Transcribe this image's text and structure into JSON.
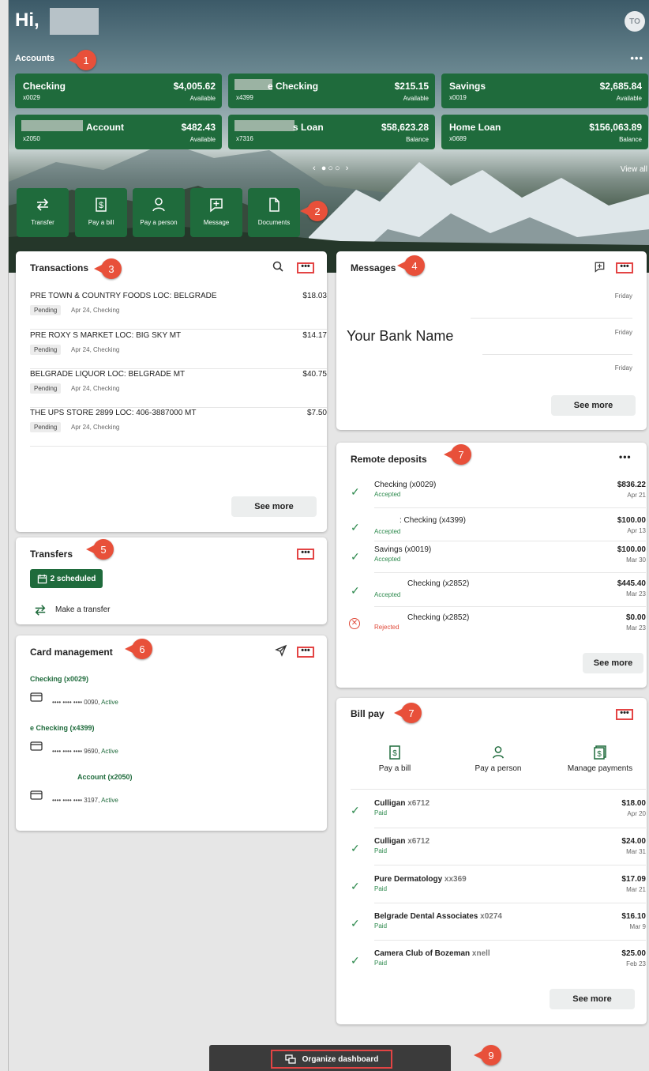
{
  "greeting": "Hi,",
  "avatar_initials": "TO",
  "accounts": {
    "title": "Accounts",
    "more": "•••",
    "view_all": "View all",
    "pager": "‹ ●○○ ›",
    "items": [
      {
        "name": "Checking",
        "number": "x0029",
        "amount": "$4,005.62",
        "label": "Available"
      },
      {
        "name": "e Checking",
        "number": "x4399",
        "amount": "$215.15",
        "label": "Available"
      },
      {
        "name": "Savings",
        "number": "x0019",
        "amount": "$2,685.84",
        "label": "Available"
      },
      {
        "name": "Account",
        "number": "x2050",
        "amount": "$482.43",
        "label": "Available"
      },
      {
        "name": "s Loan",
        "number": "x7316",
        "amount": "$58,623.28",
        "label": "Balance"
      },
      {
        "name": "Home Loan",
        "number": "x0689",
        "amount": "$156,063.89",
        "label": "Balance"
      }
    ]
  },
  "quick_actions": [
    "Transfer",
    "Pay a bill",
    "Pay a person",
    "Message",
    "Documents"
  ],
  "badges": [
    "1",
    "2",
    "3",
    "4",
    "5",
    "6",
    "7",
    "7",
    "9"
  ],
  "transactions": {
    "title": "Transactions",
    "more": "•••",
    "see_more": "See more",
    "items": [
      {
        "desc": "PRE TOWN & COUNTRY FOODS LOC: BELGRADE",
        "amount": "$18.03",
        "status": "Pending",
        "sub": "Apr 24, Checking"
      },
      {
        "desc": "PRE ROXY S MARKET LOC: BIG SKY MT",
        "amount": "$14.17",
        "status": "Pending",
        "sub": "Apr 24, Checking"
      },
      {
        "desc": "BELGRADE LIQUOR LOC: BELGRADE MT",
        "amount": "$40.75",
        "status": "Pending",
        "sub": "Apr 24, Checking"
      },
      {
        "desc": "THE UPS STORE 2899 LOC: 406-3887000 MT",
        "amount": "$7.50",
        "status": "Pending",
        "sub": "Apr 24, Checking"
      }
    ]
  },
  "messages": {
    "title": "Messages",
    "more": "•••",
    "bank_name": "Your Bank Name",
    "dates": [
      "Friday",
      "Friday",
      "Friday"
    ],
    "see_more": "See more"
  },
  "transfers": {
    "title": "Transfers",
    "more": "•••",
    "scheduled": "2 scheduled",
    "make": "Make a transfer"
  },
  "card_management": {
    "title": "Card management",
    "more": "•••",
    "groups": [
      {
        "account": "Checking (x0029)",
        "card": "•••• •••• •••• 0090,",
        "status": "Active"
      },
      {
        "account": "e Checking (x4399)",
        "card": "•••• •••• •••• 9690,",
        "status": "Active"
      },
      {
        "account": "Account (x2050)",
        "card": "•••• •••• •••• 3197,",
        "status": "Active"
      }
    ]
  },
  "remote_deposits": {
    "title": "Remote deposits",
    "more": "•••",
    "see_more": "See more",
    "items": [
      {
        "name": "Checking (x0029)",
        "status": "Accepted",
        "amount": "$836.22",
        "date": "Apr 21",
        "ok": true
      },
      {
        "name": ": Checking (x4399)",
        "status": "Accepted",
        "amount": "$100.00",
        "date": "Apr 13",
        "ok": true
      },
      {
        "name": "Savings (x0019)",
        "status": "Accepted",
        "amount": "$100.00",
        "date": "Mar 30",
        "ok": true
      },
      {
        "name": "Checking (x2852)",
        "status": "Accepted",
        "amount": "$445.40",
        "date": "Mar 23",
        "ok": true
      },
      {
        "name": "Checking (x2852)",
        "status": "Rejected",
        "amount": "$0.00",
        "date": "Mar 23",
        "ok": false
      }
    ]
  },
  "bill_pay": {
    "title": "Bill pay",
    "more": "•••",
    "actions": [
      "Pay a bill",
      "Pay a person",
      "Manage payments"
    ],
    "see_more": "See more",
    "items": [
      {
        "payee": "Culligan",
        "acct": "x6712",
        "status": "Paid",
        "amount": "$18.00",
        "date": "Apr 20"
      },
      {
        "payee": "Culligan",
        "acct": "x6712",
        "status": "Paid",
        "amount": "$24.00",
        "date": "Mar 31"
      },
      {
        "payee": "Pure Dermatology",
        "acct": "xx369",
        "status": "Paid",
        "amount": "$17.09",
        "date": "Mar 21"
      },
      {
        "payee": "Belgrade Dental Associates",
        "acct": "x0274",
        "status": "Paid",
        "amount": "$16.10",
        "date": "Mar 9"
      },
      {
        "payee": "Camera Club of Bozeman",
        "acct": "xnell",
        "status": "Paid",
        "amount": "$25.00",
        "date": "Feb 23"
      }
    ]
  },
  "organize": "Organize dashboard",
  "colors": {
    "brand_green": "#1f6b3c",
    "annotation_red": "#e8503a",
    "accepted_green": "#2e8a4e",
    "rejected_red": "#e04a3a"
  }
}
